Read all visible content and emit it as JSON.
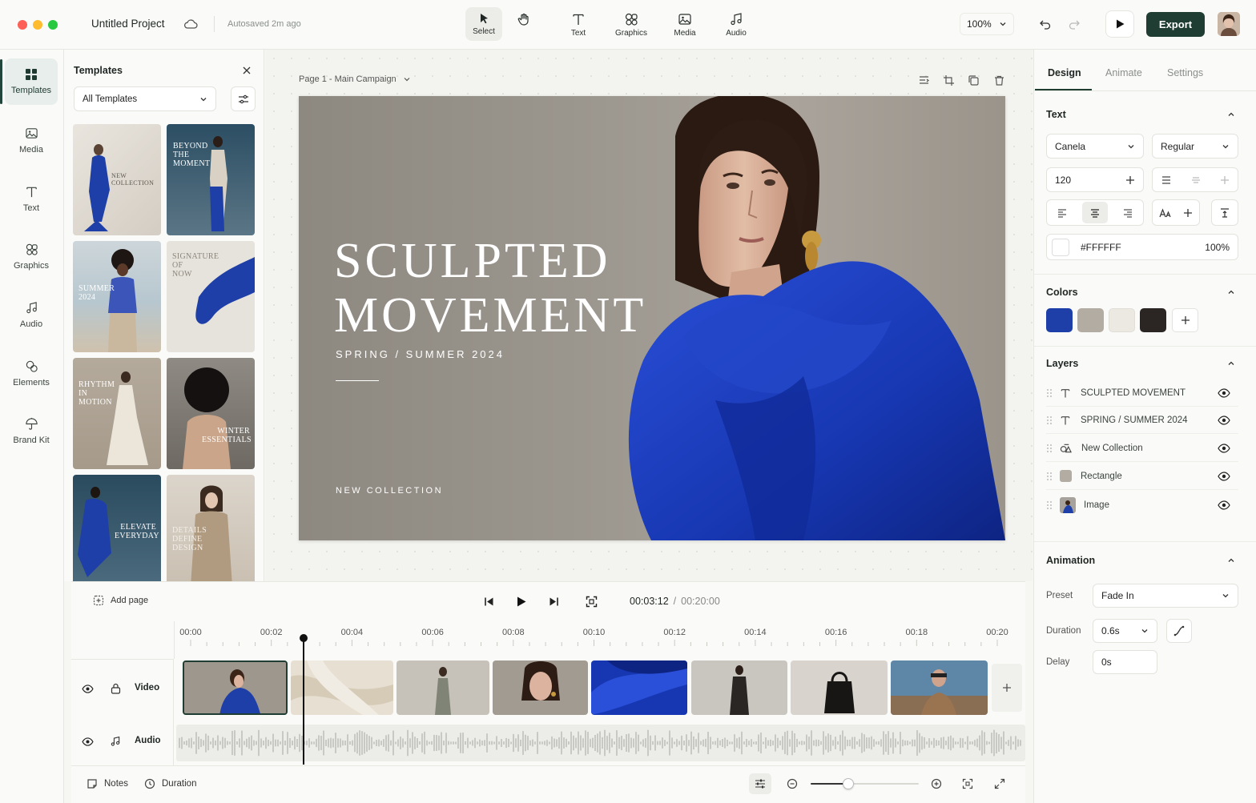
{
  "app": {
    "project_title": "Untitled Project",
    "autosave_status": "Autosaved 2m ago",
    "zoom": "100%",
    "export_label": "Export"
  },
  "toolbar": {
    "tools": [
      {
        "label": "Select",
        "icon": "cursor-icon"
      },
      {
        "label": "Text",
        "icon": "text-icon"
      },
      {
        "label": "Graphics",
        "icon": "shapes-icon"
      },
      {
        "label": "Media",
        "icon": "image-icon"
      },
      {
        "label": "Audio",
        "icon": "music-icon"
      }
    ]
  },
  "rail": {
    "items": [
      {
        "label": "Templates",
        "icon": "grid-icon"
      },
      {
        "label": "Media",
        "icon": "image-icon"
      },
      {
        "label": "Text",
        "icon": "text-icon"
      },
      {
        "label": "Graphics",
        "icon": "shapes-icon"
      },
      {
        "label": "Audio",
        "icon": "music-icon"
      },
      {
        "label": "Elements",
        "icon": "elements-icon"
      },
      {
        "label": "Brand Kit",
        "icon": "umbrella-icon"
      }
    ]
  },
  "templates_panel": {
    "title": "Templates",
    "filter_value": "All Templates",
    "thumbnails": [
      {
        "title": "NEW\nCOLLECTION"
      },
      {
        "title": "BEYOND\nTHE\nMOMENT"
      },
      {
        "title": "SUMMER\n2024"
      },
      {
        "title": "SIGNATURE\nOF\nNOW"
      },
      {
        "title": "RHYTHM\nIN\nMOTION"
      },
      {
        "title": "WINTER\nESSENTIALS"
      },
      {
        "title": "ELEVATE\nEVERYDAY"
      },
      {
        "title": "DETAILS\nDEFINE\nDESIGN"
      }
    ]
  },
  "canvas": {
    "page_label": "Page 1 - Main Campaign",
    "headline_line1": "SCULPTED",
    "headline_line2": "MOVEMENT",
    "subheadline": "SPRING / SUMMER 2024",
    "footer_text": "NEW COLLECTION"
  },
  "right_panel": {
    "tabs": [
      "Design",
      "Animate",
      "Settings"
    ],
    "text_section": {
      "title": "Text",
      "font_family": "Canela",
      "font_weight": "Regular",
      "font_size": "120",
      "color_hex": "#FFFFFF",
      "opacity": "100%"
    },
    "colors_section": {
      "title": "Colors",
      "swatches": [
        "#1e3fa8",
        "#b3aca3",
        "#ebe9e2",
        "#2b2523"
      ]
    },
    "layers_section": {
      "title": "Layers",
      "layers": [
        {
          "name": "SCULPTED MOVEMENT",
          "type": "text"
        },
        {
          "name": "SPRING / SUMMER 2024",
          "type": "text"
        },
        {
          "name": "New Collection",
          "type": "shape"
        },
        {
          "name": "Rectangle",
          "type": "rectangle"
        },
        {
          "name": "Image",
          "type": "image"
        }
      ]
    },
    "animation_section": {
      "title": "Animation",
      "preset_label": "Preset",
      "preset_value": "Fade In",
      "duration_label": "Duration",
      "duration_value": "0.6s",
      "delay_label": "Delay",
      "delay_value": "0s"
    }
  },
  "timeline": {
    "add_page_label": "Add page",
    "current_time": "00:03:12",
    "time_separator": "/",
    "total_time": "00:20:00",
    "ticks": [
      "00:00",
      "00:02",
      "00:04",
      "00:06",
      "00:08",
      "00:10",
      "00:12",
      "00:14",
      "00:16",
      "00:18",
      "00:20"
    ],
    "tracks": {
      "video": "Video",
      "audio": "Audio"
    },
    "zoom_level": 0.35
  },
  "bottombar": {
    "notes_label": "Notes",
    "duration_label": "Duration"
  },
  "colors": {
    "accent": "#1f3d33",
    "brand_blue": "#1e3fa8"
  }
}
